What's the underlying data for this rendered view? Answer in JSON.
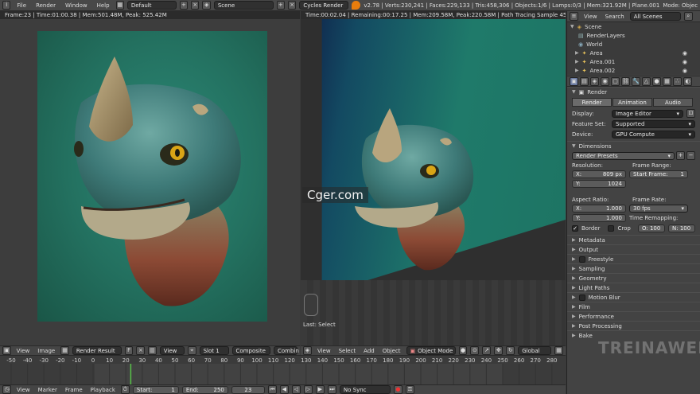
{
  "topbar": {
    "menus": [
      "File",
      "Render",
      "Window",
      "Help"
    ],
    "screen_layout": "Default",
    "scene": "Scene",
    "engine": "Cycles Render",
    "stats": "v2.78 | Verts:230,241 | Faces:229,133 | Tris:458,306 | Objects:1/6 | Lamps:0/3 | Mem:321.92M | Plane.001",
    "mode_label": "Mode: Objec"
  },
  "left_editor": {
    "header": "Frame:23 | Time:01:00.38 | Mem:501.48M, Peak: 525.42M"
  },
  "viewport": {
    "header": "Time:00:02.04 | Remaining:00:17.25 | Mem:209.58M, Peak:220.58M | Path Tracing Sample 45/400",
    "last_operator": "Last: Select"
  },
  "watermark": "Cger.com",
  "outliner": {
    "tabs": [
      "View",
      "Search"
    ],
    "filter": "All Scenes",
    "items": [
      "Scene",
      "RenderLayers",
      "World",
      "Area",
      "Area.001",
      "Area.002"
    ]
  },
  "properties": {
    "render_header": "Render",
    "buttons": [
      "Render",
      "Animation",
      "Audio"
    ],
    "display_label": "Display:",
    "display_value": "Image Editor",
    "feature_label": "Feature Set:",
    "feature_value": "Supported",
    "device_label": "Device:",
    "device_value": "GPU Compute",
    "dimensions_header": "Dimensions",
    "presets": "Render Presets",
    "resolution_label": "Resolution:",
    "res_x": "X:",
    "res_x_value": "809 px",
    "res_y": "Y:",
    "res_y_value": "1024",
    "frame_range_label": "Frame Range:",
    "start_frame": "Start Frame:",
    "start_frame_value": "1",
    "aspect_label": "Aspect Ratio:",
    "aspect_x": "X:",
    "aspect_x_value": "1.000",
    "aspect_y": "Y:",
    "aspect_y_value": "1.000",
    "frame_rate_label": "Frame Rate:",
    "frame_rate_value": "30 fps",
    "time_remap_label": "Time Remapping:",
    "remap_old": "O: 100",
    "remap_new": "N: 100",
    "border_label": "Border",
    "crop_label": "Crop",
    "panels": [
      "Metadata",
      "Output",
      "Freestyle",
      "Sampling",
      "Geometry",
      "Light Paths",
      "Motion Blur",
      "Film",
      "Performance",
      "Post Processing",
      "Bake"
    ]
  },
  "image_header": {
    "view": "View",
    "image": "Image",
    "image_name": "Render Result",
    "fake_user": "F",
    "view2": "View",
    "slot": "Slot 1",
    "pass": "Composite",
    "combined": "Combin"
  },
  "view3d_header": {
    "menus": [
      "View",
      "Select",
      "Add",
      "Object"
    ],
    "mode": "Object Mode",
    "orientation": "Global"
  },
  "timeline": {
    "ticks": [
      "-50",
      "-40",
      "-30",
      "-20",
      "-10",
      "0",
      "10",
      "20",
      "30",
      "40",
      "50",
      "60",
      "70",
      "80",
      "90",
      "100",
      "110",
      "120",
      "130",
      "140",
      "150",
      "160",
      "170",
      "180",
      "190",
      "200",
      "210",
      "220",
      "230",
      "240",
      "250",
      "260",
      "270",
      "280"
    ],
    "current_frame": 23,
    "menus": [
      "View",
      "Marker",
      "Frame",
      "Playback"
    ],
    "start_label": "Start:",
    "start_value": "1",
    "end_label": "End:",
    "end_value": "250",
    "current_label": "23",
    "sync": "No Sync"
  },
  "brand_watermark": "TREINAWEB"
}
